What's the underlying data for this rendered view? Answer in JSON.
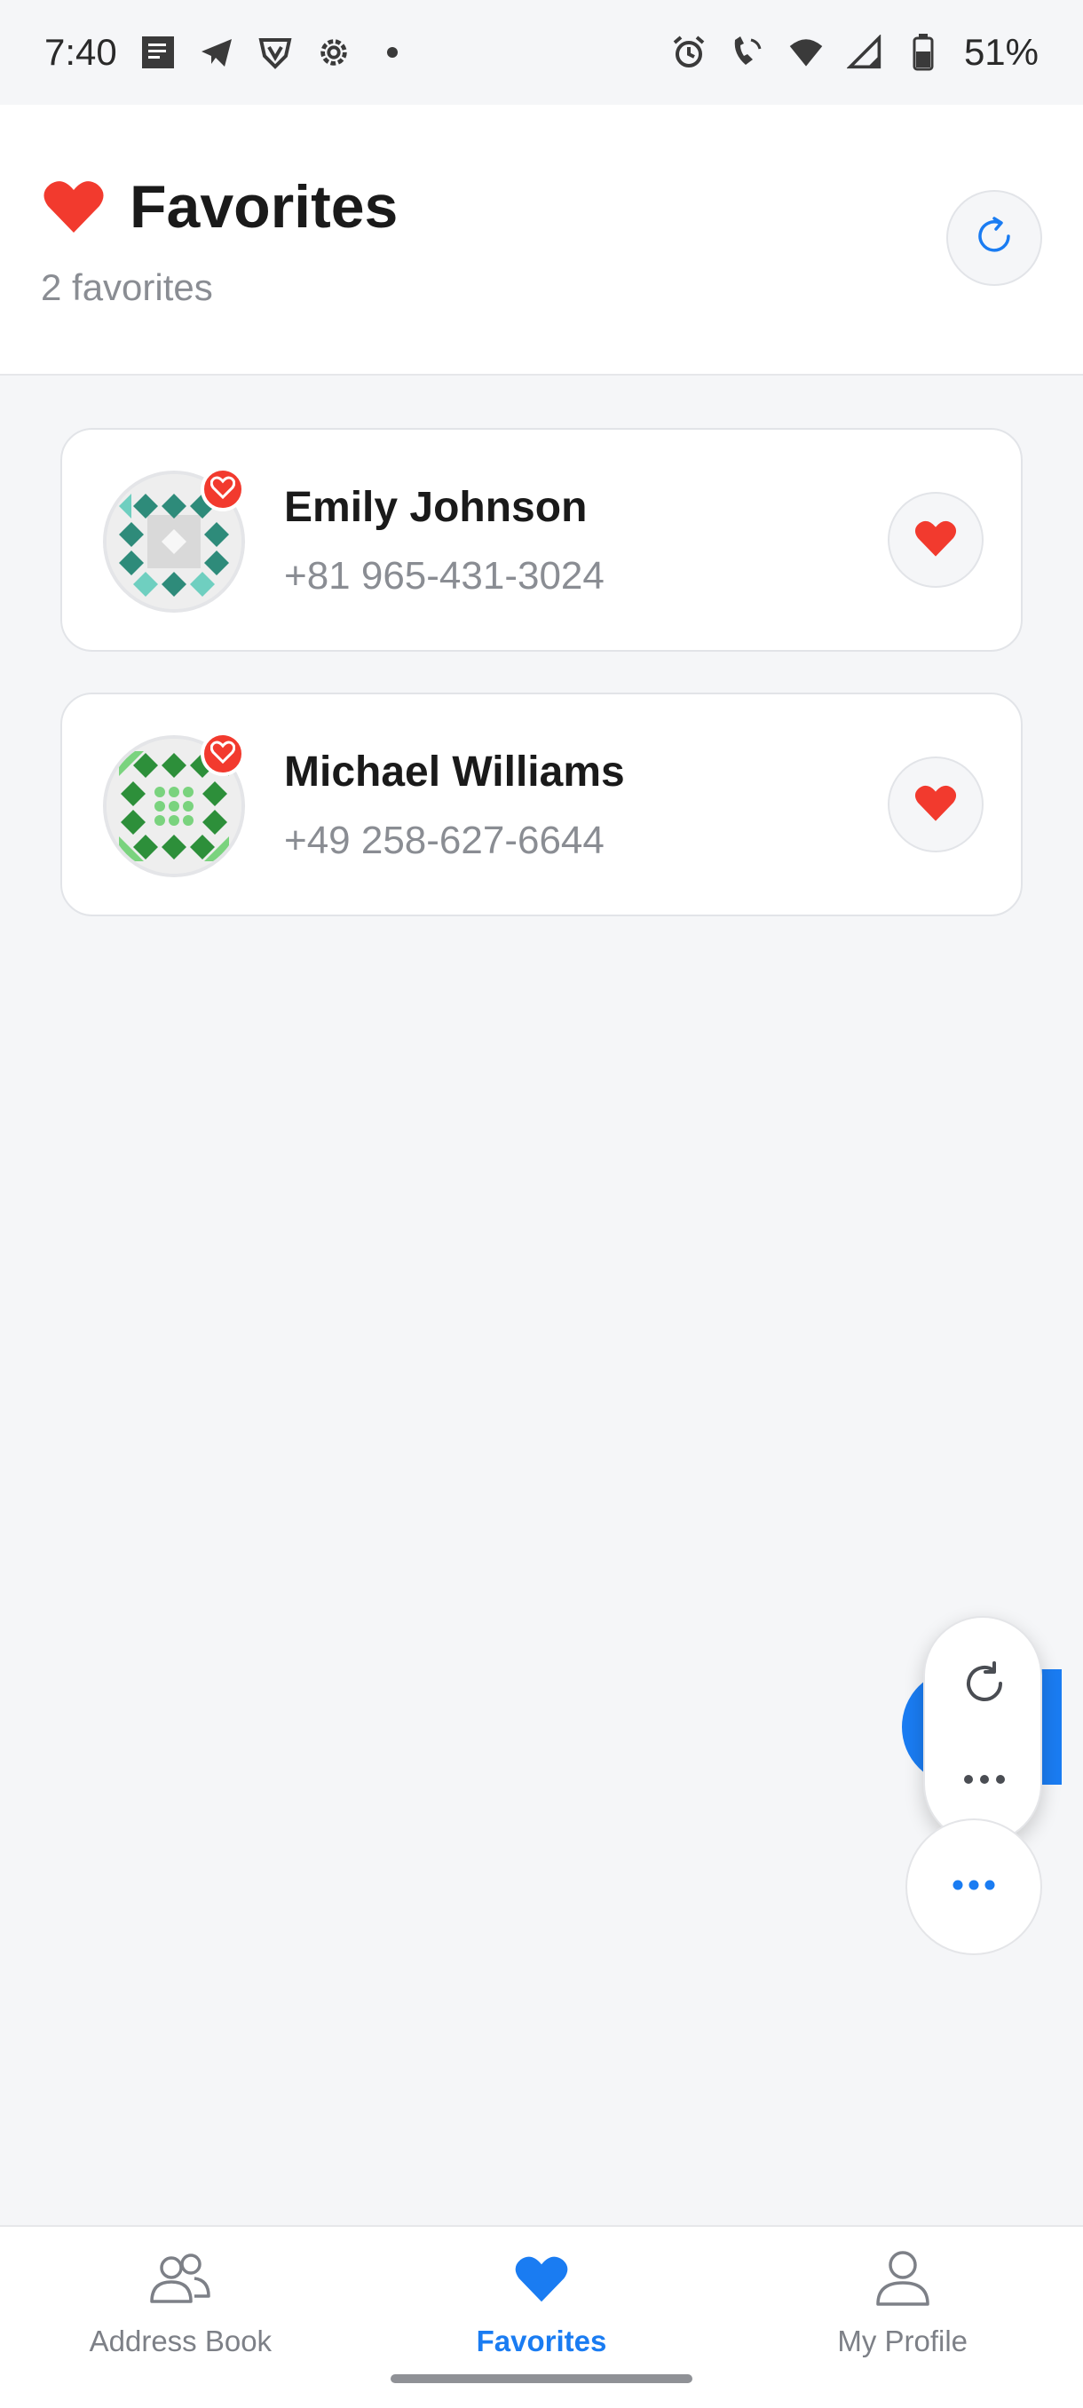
{
  "status_bar": {
    "time": "7:40",
    "battery": "51%",
    "left_icons": [
      "notes-icon",
      "telegram-icon",
      "vpn-shield-icon",
      "settings-icon",
      "dot-icon"
    ],
    "right_icons": [
      "alarm-icon",
      "wifi-call-icon",
      "wifi-icon",
      "signal-icon",
      "battery-icon"
    ]
  },
  "header": {
    "title": "Favorites",
    "subtitle": "2 favorites",
    "icon": "heart-icon",
    "refresh_icon": "refresh-icon"
  },
  "contacts": [
    {
      "name": "Emily Johnson",
      "phone": "+81 965-431-3024",
      "avatar_color": "#2e8b7a",
      "avatar_accent": "#6fcfc0"
    },
    {
      "name": "Michael Williams",
      "phone": "+49 258-627-6644",
      "avatar_color": "#2d8f3a",
      "avatar_accent": "#7ad37e"
    }
  ],
  "floating_menu": {
    "refresh_icon": "refresh-icon",
    "more_icon": "more-horizontal-icon",
    "fab_icon": "more-horizontal-icon"
  },
  "bottom_nav": {
    "items": [
      {
        "label": "Address Book",
        "icon": "people-icon",
        "active": false
      },
      {
        "label": "Favorites",
        "icon": "heart-icon",
        "active": true
      },
      {
        "label": "My Profile",
        "icon": "person-icon",
        "active": false
      }
    ]
  },
  "colors": {
    "accent": "#1a7cf2",
    "heart": "#f23a2e",
    "background": "#f5f6f8"
  }
}
